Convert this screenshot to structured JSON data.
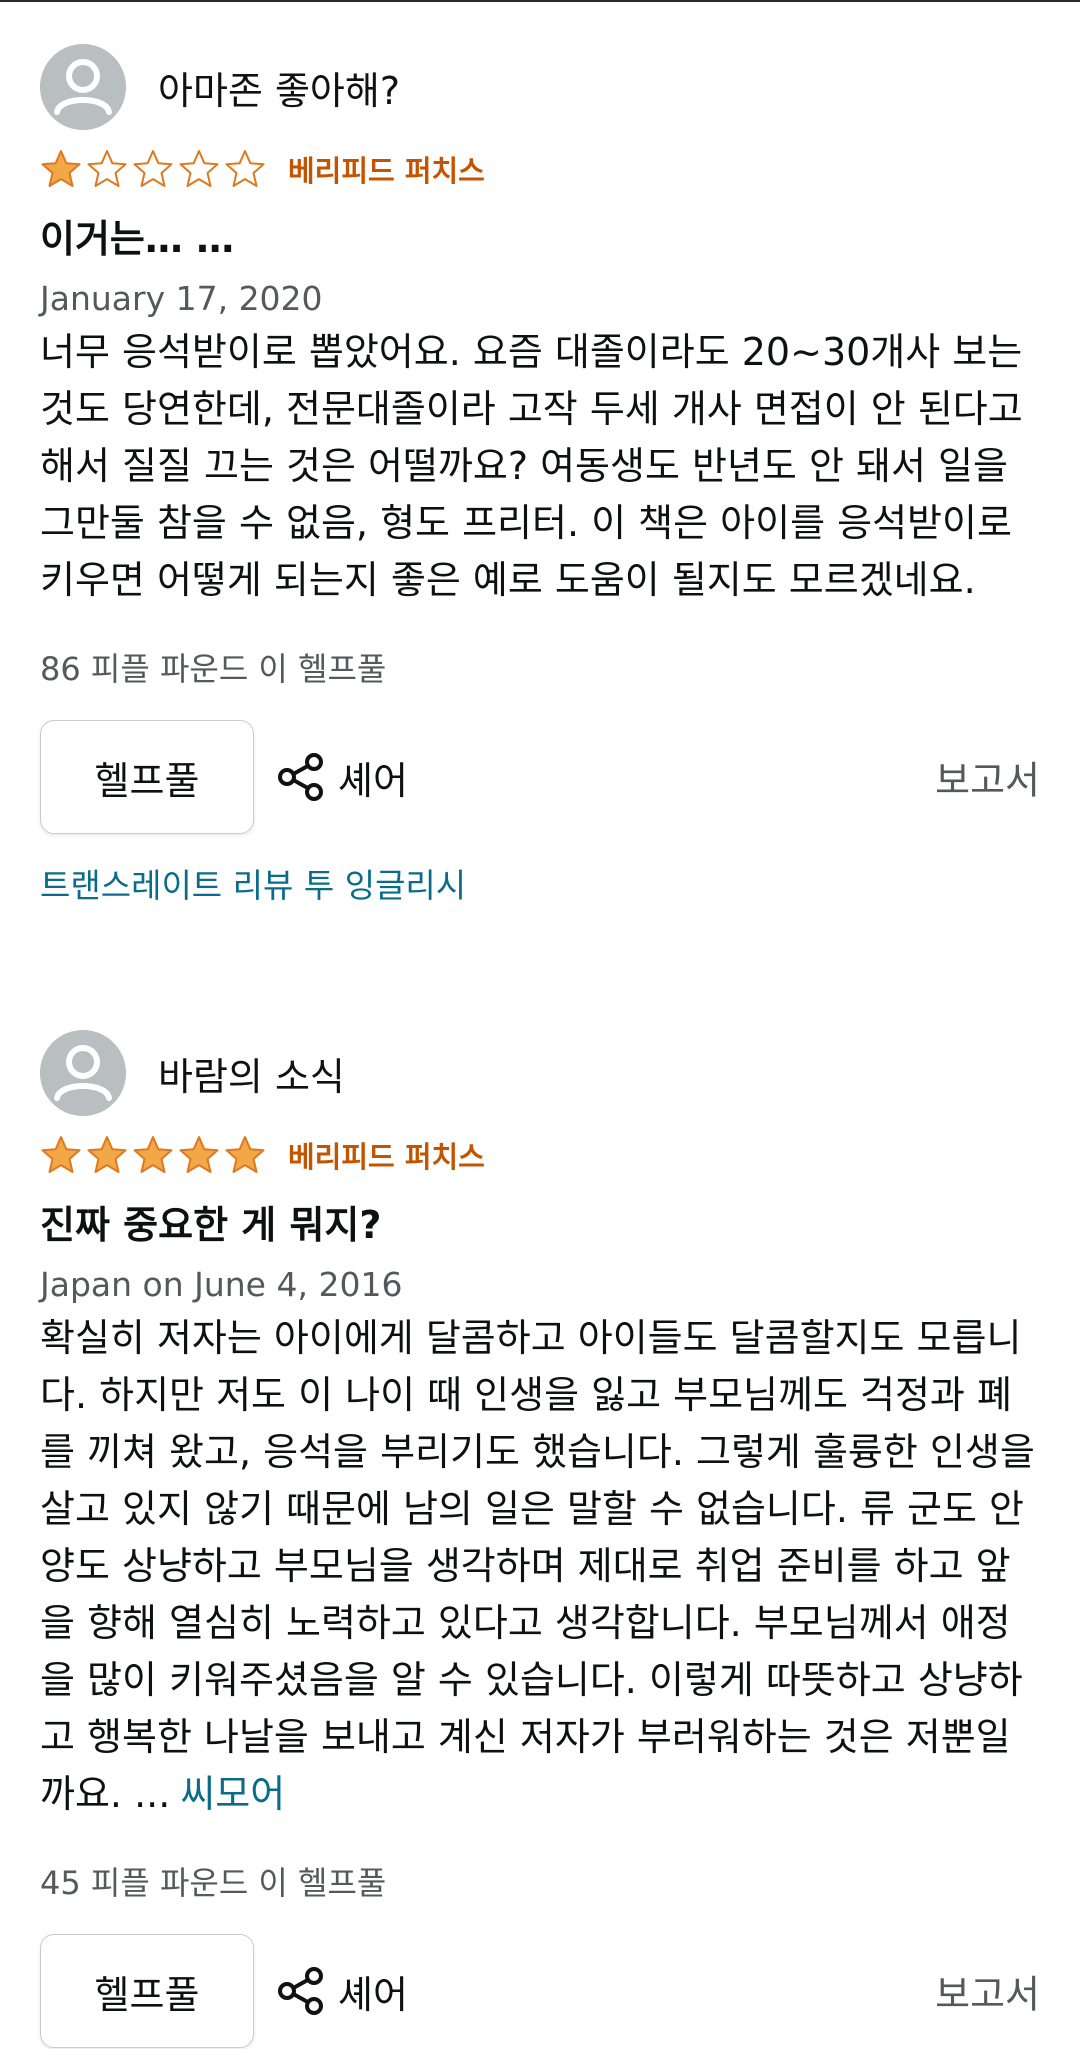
{
  "colors": {
    "star": "#f3a847",
    "star_outline": "#de7921",
    "verified": "#c45500",
    "link": "#0a6c8a",
    "muted": "#565959"
  },
  "reviews": [
    {
      "username": "아마존 좋아해?",
      "rating": 1,
      "rating_max": 5,
      "verified": "베리피드 퍼치스",
      "title": "이거는… …",
      "date": "January 17, 2020",
      "body": "너무 응석받이로 뽑았어요. 요즘 대졸이라도 20~30개사 보는 것도 당연한데, 전문대졸이라 고작 두세 개사 면접이 안 된다고 해서 질질 끄는 것은 어떨까요? 여동생도 반년도 안 돼서 일을 그만둘 참을 수 없음, 형도 프리터. 이 책은 아이를 응석받이로 키우면 어떻게 되는지 좋은 예로 도움이 될지도 모르겠네요.",
      "see_more": "",
      "helpful_count": "86 피플 파운드 이 헬프풀",
      "helpful_label": "헬프풀",
      "share_label": "셰어",
      "report_label": "보고서",
      "translate_label": "트랜스레이트 리뷰 투 잉글리시"
    },
    {
      "username": "바람의 소식",
      "rating": 5,
      "rating_max": 5,
      "verified": "베리피드 퍼치스",
      "title": "진짜 중요한 게 뭐지?",
      "date": "Japan on June 4, 2016",
      "body": "확실히 저자는 아이에게 달콤하고 아이들도 달콤할지도 모릅니다. 하지만 저도 이 나이 때 인생을 잃고 부모님께도 걱정과 폐를 끼쳐 왔고, 응석을 부리기도 했습니다. 그렇게 훌륭한 인생을 살고 있지 않기 때문에 남의 일은 말할 수 없습니다. 류 군도 안 양도 상냥하고 부모님을 생각하며 제대로 취업 준비를 하고 앞을 향해 열심히 노력하고 있다고 생각합니다. 부모님께서 애정을 많이 키워주셨음을 알 수 있습니다. 이렇게 따뜻하고 상냥하고 행복한 나날을 보내고 계신 저자가 부러워하는 것은 저뿐일까요. ...",
      "see_more": "씨모어",
      "helpful_count": "45 피플 파운드 이 헬프풀",
      "helpful_label": "헬프풀",
      "share_label": "셰어",
      "report_label": "보고서",
      "translate_label": ""
    }
  ]
}
